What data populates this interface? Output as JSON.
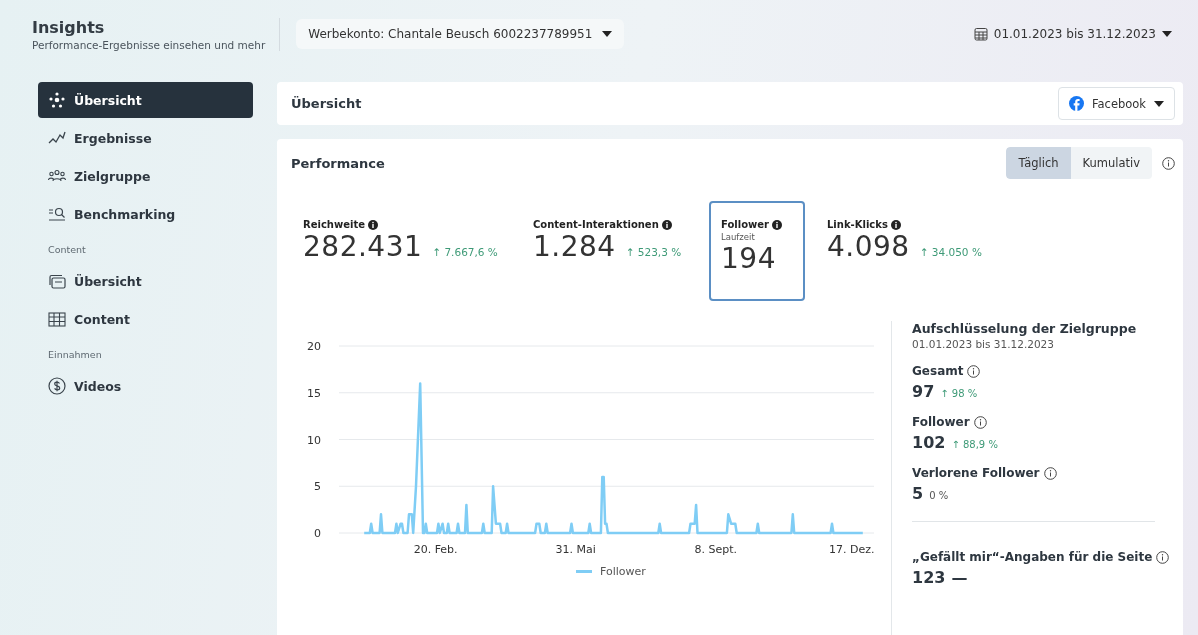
{
  "header": {
    "title": "Insights",
    "subtitle": "Performance-Ergebnisse einsehen und mehr",
    "account": "Werbekonto: Chantale Beusch 6002237789951",
    "date_range": "01.01.2023 bis 31.12.2023"
  },
  "sidebar": {
    "items": [
      {
        "kind": "item",
        "label": "Übersicht",
        "selected": true
      },
      {
        "kind": "item",
        "label": "Ergebnisse",
        "selected": false
      },
      {
        "kind": "item",
        "label": "Zielgruppe",
        "selected": false
      },
      {
        "kind": "item",
        "label": "Benchmarking",
        "selected": false
      },
      {
        "kind": "section",
        "label": "Content"
      },
      {
        "kind": "item",
        "label": "Übersicht",
        "selected": false
      },
      {
        "kind": "item",
        "label": "Content",
        "selected": false
      },
      {
        "kind": "section",
        "label": "Einnahmen"
      },
      {
        "kind": "item",
        "label": "Videos",
        "selected": false
      }
    ]
  },
  "overview": {
    "title": "Übersicht",
    "platform": "Facebook"
  },
  "performance": {
    "title": "Performance",
    "toggle": [
      {
        "label": "Täglich",
        "selected": true
      },
      {
        "label": "Kumulativ",
        "selected": false
      }
    ],
    "metrics": [
      {
        "label": "Reichweite",
        "value": "282.431",
        "change": "↑ 7.667,6 %",
        "selected": false
      },
      {
        "label": "Content-Interaktionen",
        "value": "1.284",
        "change": "↑ 523,3 %",
        "selected": false
      },
      {
        "label": "Follower",
        "sublabel": "Laufzeit",
        "value": "194",
        "selected": true
      },
      {
        "label": "Link-Klicks",
        "value": "4.098",
        "change": "↑ 34.050 %",
        "selected": false
      }
    ],
    "chart_data": {
      "type": "line",
      "grid": true,
      "x": [
        "2022-12-31",
        "2023-01-04",
        "2023-01-05",
        "2023-01-06",
        "2023-01-11",
        "2023-01-12",
        "2023-01-13",
        "2023-01-22",
        "2023-01-23",
        "2023-01-24",
        "2023-01-26",
        "2023-01-27",
        "2023-01-28",
        "2023-01-31",
        "2023-02-01",
        "2023-02-03",
        "2023-02-04",
        "2023-02-06",
        "2023-02-09",
        "2023-02-11",
        "2023-02-12",
        "2023-02-13",
        "2023-02-14",
        "2023-02-21",
        "2023-02-22",
        "2023-02-23",
        "2023-02-25",
        "2023-02-26",
        "2023-02-28",
        "2023-03-01",
        "2023-03-02",
        "2023-03-07",
        "2023-03-08",
        "2023-03-09",
        "2023-03-13",
        "2023-03-14",
        "2023-03-15",
        "2023-03-25",
        "2023-03-26",
        "2023-03-27",
        "2023-04-01",
        "2023-04-02",
        "2023-04-04",
        "2023-04-06",
        "2023-04-07",
        "2023-04-08",
        "2023-04-11",
        "2023-04-12",
        "2023-04-13",
        "2023-05-02",
        "2023-05-03",
        "2023-05-05",
        "2023-05-06",
        "2023-05-09",
        "2023-05-10",
        "2023-05-11",
        "2023-05-27",
        "2023-05-28",
        "2023-05-29",
        "2023-06-09",
        "2023-06-10",
        "2023-06-11",
        "2023-06-18",
        "2023-06-19",
        "2023-06-20",
        "2023-06-21",
        "2023-06-22",
        "2023-06-23",
        "2023-07-29",
        "2023-07-30",
        "2023-07-31",
        "2023-08-20",
        "2023-08-21",
        "2023-08-24",
        "2023-08-25",
        "2023-08-26",
        "2023-09-16",
        "2023-09-17",
        "2023-09-19",
        "2023-09-20",
        "2023-09-22",
        "2023-09-23",
        "2023-10-07",
        "2023-10-08",
        "2023-10-09",
        "2023-11-01",
        "2023-11-02",
        "2023-11-03",
        "2023-11-29",
        "2023-11-30",
        "2023-12-01",
        "2023-12-22"
      ],
      "series": [
        {
          "name": "Follower",
          "color": "#7fcdf5",
          "values": [
            0,
            0,
            1,
            0,
            0,
            2,
            0,
            0,
            1,
            0,
            1,
            1,
            0,
            0,
            2,
            2,
            0,
            5,
            16,
            0,
            0,
            1,
            0,
            0,
            1,
            0,
            1,
            0,
            0,
            1,
            0,
            0,
            1,
            0,
            0,
            3,
            0,
            0,
            1,
            0,
            0,
            5,
            1,
            1,
            1,
            0,
            0,
            1,
            0,
            0,
            1,
            1,
            0,
            0,
            1,
            0,
            0,
            1,
            0,
            0,
            1,
            0,
            0,
            6,
            6,
            1,
            1,
            0,
            0,
            1,
            0,
            0,
            1,
            1,
            3,
            0,
            0,
            2,
            1,
            1,
            1,
            0,
            0,
            1,
            0,
            0,
            2,
            0,
            0,
            1,
            0,
            0
          ]
        }
      ],
      "xlim": [
        "2022-12-13",
        "2023-12-30"
      ],
      "ylim": [
        0,
        20
      ],
      "yticks": [
        0,
        5,
        10,
        15,
        20
      ],
      "xticks": [
        {
          "value": "2023-02-20",
          "label": "20. Feb."
        },
        {
          "value": "2023-05-31",
          "label": "31. Mai"
        },
        {
          "value": "2023-09-08",
          "label": "8. Sept."
        },
        {
          "value": "2023-12-17",
          "label": "17. Dez."
        }
      ]
    }
  },
  "breakdown": {
    "title": "Aufschlüsselung der Zielgruppe",
    "date_range": "01.01.2023 bis 31.12.2023",
    "stats": [
      {
        "label": "Gesamt",
        "value": "97",
        "change": "↑ 98 %"
      },
      {
        "label": "Follower",
        "value": "102",
        "change": "↑ 88,9 %"
      },
      {
        "label": "Verlorene Follower",
        "value": "5",
        "change": "0 %"
      }
    ],
    "likes": {
      "label": "„Gefällt mir“-Angaben für die Seite",
      "value": "123",
      "change": "—"
    }
  }
}
